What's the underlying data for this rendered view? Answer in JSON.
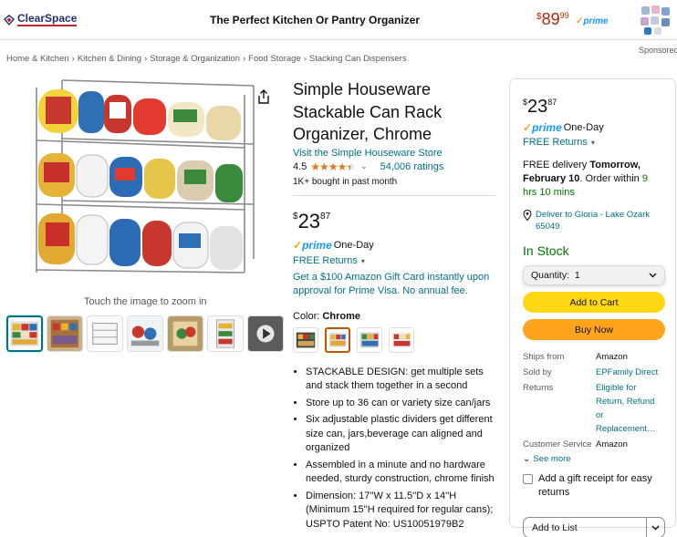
{
  "banner": {
    "brand": "ClearSpace",
    "title": "The Perfect Kitchen Or Pantry Organizer",
    "price_symbol": "$",
    "price_whole": "89",
    "price_fraction": "99",
    "prime": "prime",
    "sponsored": "Sponsored"
  },
  "breadcrumb": [
    "Home & Kitchen",
    "Kitchen & Dining",
    "Storage & Organization",
    "Food Storage",
    "Stacking Can Dispensers"
  ],
  "breadcrumb_sep": "›",
  "gallery": {
    "zoom_hint": "Touch the image to zoom in",
    "thumbnail_count": 7,
    "selected_index": 0
  },
  "product": {
    "title": "Simple Houseware Stackable Can Rack Organizer, Chrome",
    "store_link": "Visit the Simple Houseware Store",
    "rating": "4.5",
    "stars_filled": 4.5,
    "ratings_count": "54,006 ratings",
    "bought": "1K+ bought in past month",
    "price_symbol": "$",
    "price_whole": "23",
    "price_fraction": "87",
    "prime_logo": "prime",
    "prime_delivery": "One-Day",
    "free_returns": "FREE Returns",
    "gift_offer": "Get a $100 Amazon Gift Card instantly upon approval for Prime Visa. No annual fee.",
    "color_label": "Color:",
    "color_value": "Chrome",
    "bullets": [
      "STACKABLE DESIGN: get multiple sets and stack them together in a second",
      "Store up to 36 can or variety size can/jars",
      "Six adjustable plastic dividers get different size can, jars,beverage can aligned and organized",
      "Assembled in a minute and no hardware needed, sturdy construction, chrome finish",
      "Dimension: 17''W x 11.5''D x 14''H (Minimum 15''H required for regular cans); USPTO Patent No: US10051979B2"
    ]
  },
  "buybox": {
    "price_symbol": "$",
    "price_whole": "23",
    "price_fraction": "87",
    "prime_logo": "prime",
    "prime_delivery": "One-Day",
    "free_returns": "FREE Returns",
    "delivery_prefix": "FREE delivery",
    "delivery_date": "Tomorrow, February 10",
    "delivery_mid": ". Order within",
    "delivery_countdown": "9 hrs 10 mins",
    "deliver_to": "Deliver to Gloria - Lake Ozark 65049",
    "stock": "In Stock",
    "quantity_label": "Quantity:",
    "quantity_value": "1",
    "add_to_cart": "Add to Cart",
    "buy_now": "Buy Now",
    "details": {
      "ships_from_label": "Ships from",
      "ships_from": "Amazon",
      "sold_by_label": "Sold by",
      "sold_by": "EPFamily Direct",
      "returns_label": "Returns",
      "returns": "Eligible for Return, Refund or Replacement…",
      "service_label": "Customer Service",
      "service": "Amazon"
    },
    "see_more": "See more",
    "gift_receipt": "Add a gift receipt for easy returns",
    "add_to_list": "Add to List"
  },
  "colors": {
    "link": "#007185",
    "price_red": "#b12704",
    "in_stock_green": "#007600",
    "cart_yellow": "#ffd814",
    "buy_orange": "#ffa41c",
    "star_orange": "#de7921",
    "prime_blue": "#1399ff"
  }
}
